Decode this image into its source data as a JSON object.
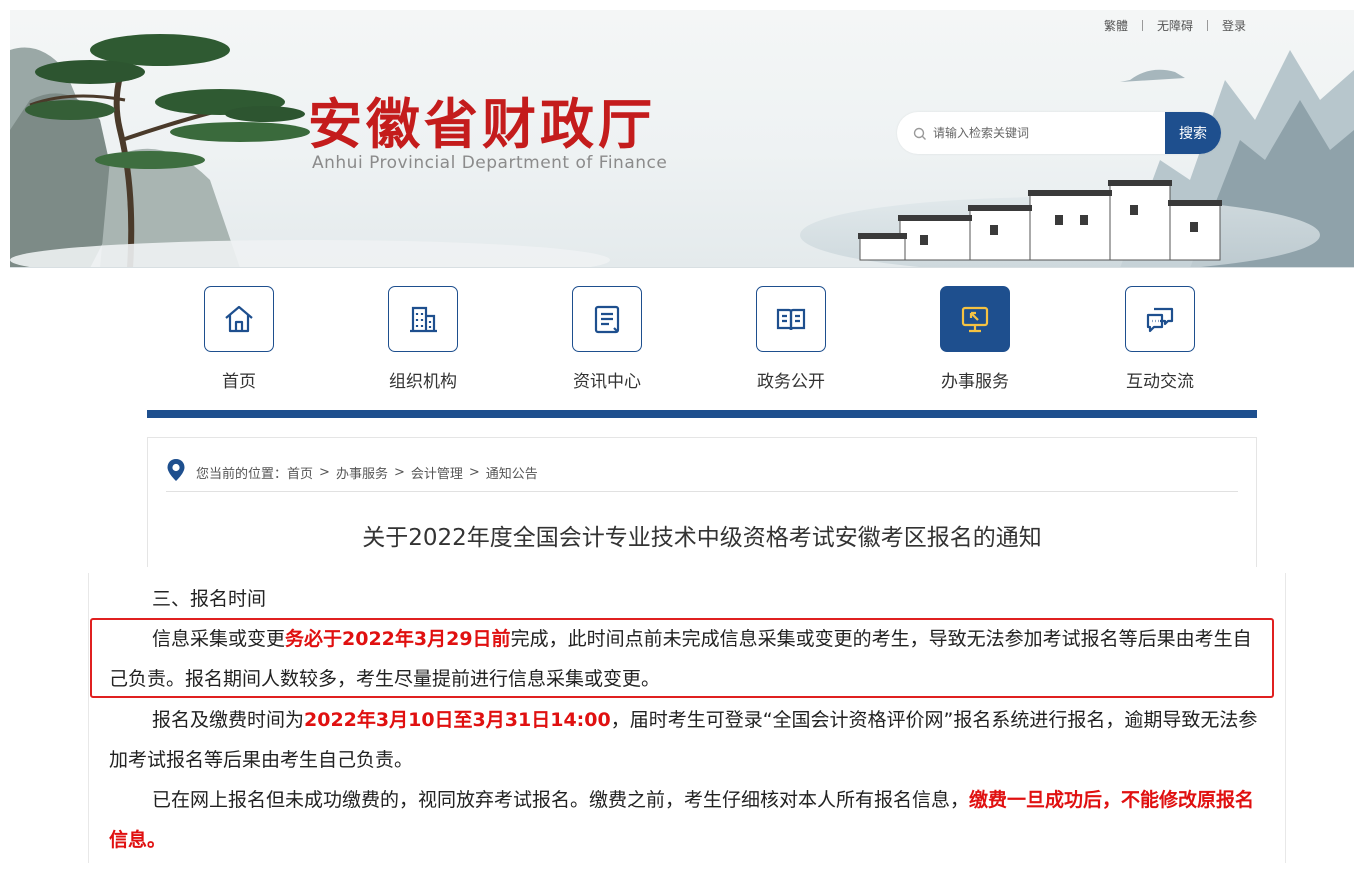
{
  "toplinks": [
    "繁體",
    "无障碍",
    "登录"
  ],
  "site": {
    "name_cn": "安徽省财政厅",
    "name_en": "Anhui Provincial Department of Finance"
  },
  "search": {
    "placeholder": "请输入检索关键词",
    "button": "搜索"
  },
  "nav": [
    {
      "label": "首页",
      "icon": "home-icon"
    },
    {
      "label": "组织机构",
      "icon": "building-icon"
    },
    {
      "label": "资讯中心",
      "icon": "document-icon"
    },
    {
      "label": "政务公开",
      "icon": "book-icon"
    },
    {
      "label": "办事服务",
      "icon": "monitor-icon",
      "active": true
    },
    {
      "label": "互动交流",
      "icon": "chat-icon"
    }
  ],
  "breadcrumb": {
    "prefix": "您当前的位置：",
    "items": [
      "首页",
      "办事服务",
      "会计管理",
      "通知公告"
    ],
    "separator": ">"
  },
  "article": {
    "title": "关于2022年度全国会计专业技术中级资格考试安徽考区报名的通知",
    "section_heading": "三、报名时间",
    "p1": {
      "a": "信息采集或变更",
      "b": "务必于2022年3月29日前",
      "c": "完成，此时间点前未完成信息采集或变更的考生，导致无法参加考试报名等后果由考生自己负责。报名期间人数较多，考生尽量提前进行信息采集或变更。"
    },
    "p2": {
      "a": "报名及缴费时间为",
      "b": "2022年3月10日至3月31日14:00",
      "c": "，届时考生可登录“全国会计资格评价网”报名系统进行报名，逾期导致无法参加考试报名等后果由考生自己负责。"
    },
    "p3": {
      "a": "已在网上报名但未成功缴费的，视同放弃考试报名。缴费之前，考生仔细核对本人所有报名信息，",
      "b": "缴费一旦成功后，不能修改原报名信息。"
    }
  },
  "colors": {
    "brand_blue": "#1e4f8e",
    "logo_red": "#c41c1c",
    "emphasis_red": "#e01010",
    "highlight_border": "#e02020"
  }
}
